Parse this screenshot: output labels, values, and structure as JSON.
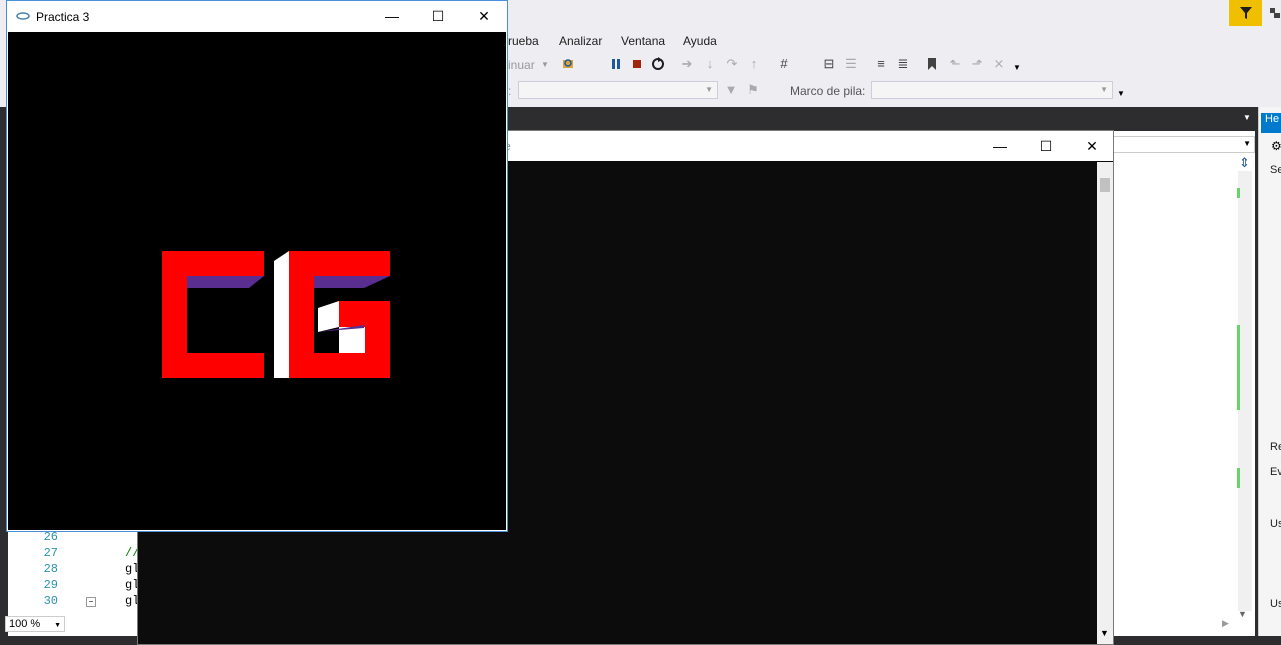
{
  "ide": {
    "menu": [
      "rueba",
      "Analizar",
      "Ventana",
      "Ayuda"
    ],
    "toolbar": {
      "continue_label": "inuar",
      "stack_frame_label": "Marco de pila:",
      "process_label": ":"
    },
    "editor": {
      "line_numbers": [
        "26",
        "27",
        "28",
        "29",
        "30"
      ],
      "code_fragments": [
        "",
        "//",
        "gl",
        "gl",
        "gl"
      ],
      "zoom": "100 %"
    },
    "side_panel": {
      "header": "He",
      "items": [
        "Se",
        "Re",
        "Ev",
        "Us",
        "Us"
      ]
    },
    "colors": {
      "accent": "#f0c000",
      "background": "#2d2d30",
      "chrome": "#eeeef2"
    }
  },
  "console_window": {
    "title": "e"
  },
  "gl_window": {
    "title": "Practica 3",
    "letters": "CG",
    "colors": {
      "canvas": "#000000",
      "letter": "#ff0000",
      "bevel": "#5a2d91",
      "side": "#ffffff"
    }
  }
}
